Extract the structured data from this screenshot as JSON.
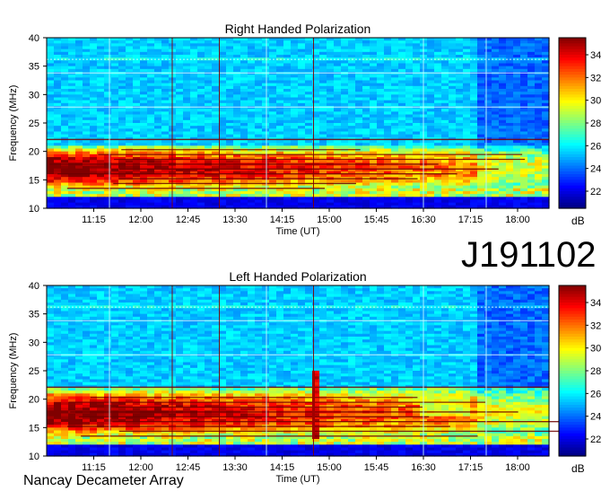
{
  "page": {
    "observation_id": "J191102",
    "instrument": "Nancay Decameter Array"
  },
  "colorscale": {
    "stops": [
      "#00007f",
      "#0000ff",
      "#0080ff",
      "#00ffff",
      "#80ff80",
      "#ffff00",
      "#ff8000",
      "#ff0000",
      "#800000"
    ],
    "range": [
      20.5,
      35.5
    ]
  },
  "chart_data": [
    {
      "type": "heatmap",
      "title": "Right Handed Polarization",
      "xlabel": "Time (UT)",
      "ylabel": "Frequency (MHz)",
      "x_ticks": [
        "11:15",
        "12:00",
        "12:45",
        "13:30",
        "14:15",
        "15:00",
        "15:45",
        "16:30",
        "17:15",
        "18:00"
      ],
      "y_ticks": [
        "10",
        "15",
        "20",
        "25",
        "30",
        "35",
        "40"
      ],
      "ylim": [
        10,
        40
      ],
      "colorbar": {
        "label": "dB",
        "ticks": [
          "22",
          "24",
          "26",
          "28",
          "30",
          "32",
          "34"
        ],
        "range": [
          20.5,
          35.5
        ]
      },
      "features": {
        "hot_band_mhz": [
          13,
          21
        ],
        "rfi_line_mhz": [
          36.2,
          33.8,
          27.8,
          22.1
        ],
        "vertical_lines_time": [
          "11:30",
          "12:30",
          "13:15",
          "14:00",
          "14:45",
          "16:30",
          "17:30"
        ]
      }
    },
    {
      "type": "heatmap",
      "title": "Left Handed Polarization",
      "xlabel": "Time (UT)",
      "ylabel": "Frequency (MHz)",
      "x_ticks": [
        "11:15",
        "12:00",
        "12:45",
        "13:30",
        "14:15",
        "15:00",
        "15:45",
        "16:30",
        "17:15",
        "18:00"
      ],
      "y_ticks": [
        "10",
        "15",
        "20",
        "25",
        "30",
        "35",
        "40"
      ],
      "ylim": [
        10,
        40
      ],
      "colorbar": {
        "label": "dB",
        "ticks": [
          "22",
          "24",
          "26",
          "28",
          "30",
          "32",
          "34"
        ],
        "range": [
          20.5,
          35.5
        ]
      },
      "features": {
        "hot_band_mhz": [
          13,
          22
        ],
        "rfi_line_mhz": [
          36.2,
          33.8,
          27.8,
          22.1
        ],
        "vertical_lines_time": [
          "11:30",
          "12:30",
          "13:15",
          "14:00",
          "14:45",
          "16:30",
          "17:30"
        ],
        "burst": {
          "time": "14:45",
          "freq_mhz": [
            13,
            25
          ]
        }
      }
    }
  ]
}
